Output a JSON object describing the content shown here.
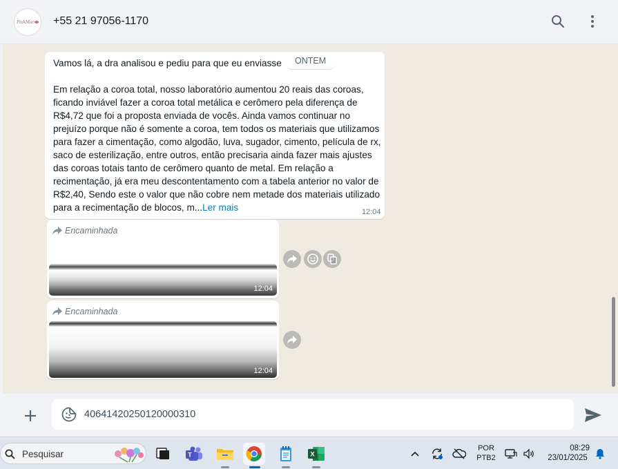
{
  "header": {
    "avatar_text": "PinkMar",
    "contact": "+55 21 97056-1170",
    "search_icon": "search-icon",
    "menu_icon": "kebab-menu-icon"
  },
  "chat": {
    "date_chip": "ONTEM",
    "message1": {
      "text": "Vamos lá, a dra analisou e pediu para que eu enviasse\n\nEm relação a coroa total, nosso laboratório aumentou 20 reais das coroas, ficando inviável fazer a coroa total metálica e cerômero pela diferença de R$4,72 que foi a proposta enviada de vocês. Ainda vamos continuar no prejuízo porque não é somente a coroa, tem todos os materiais que utilizamos para fazer a cimentação, como algodão, luva, sugador, cimento, película de rx, saco de esterilização, entre outros, então precisaria ainda fazer mais ajustes das coroas totais tanto de cerômero quanto de metal. Em relação a recimentação, já era meu descontentamento com a tabela anterior no valor de R$2,40, Sendo este o valor que não cobre nem metade dos materiais utilizado para a recimentação de blocos, m...",
      "read_more": "Ler mais",
      "time": "12:04"
    },
    "message2": {
      "forwarded": "Encaminhada",
      "time": "12:04"
    },
    "message3": {
      "forwarded": "Encaminhada",
      "time": "12:04"
    }
  },
  "composer": {
    "value": "40641420250120000310"
  },
  "taskbar": {
    "search_placeholder": "Pesquisar",
    "lang_line1": "POR",
    "lang_line2": "PTB2",
    "clock_time": "08:29",
    "clock_date": "23/01/2025"
  },
  "colors": {
    "accent_link": "#027eb5",
    "header_bg": "#f0f2f5",
    "chat_bg": "#efeae2"
  }
}
